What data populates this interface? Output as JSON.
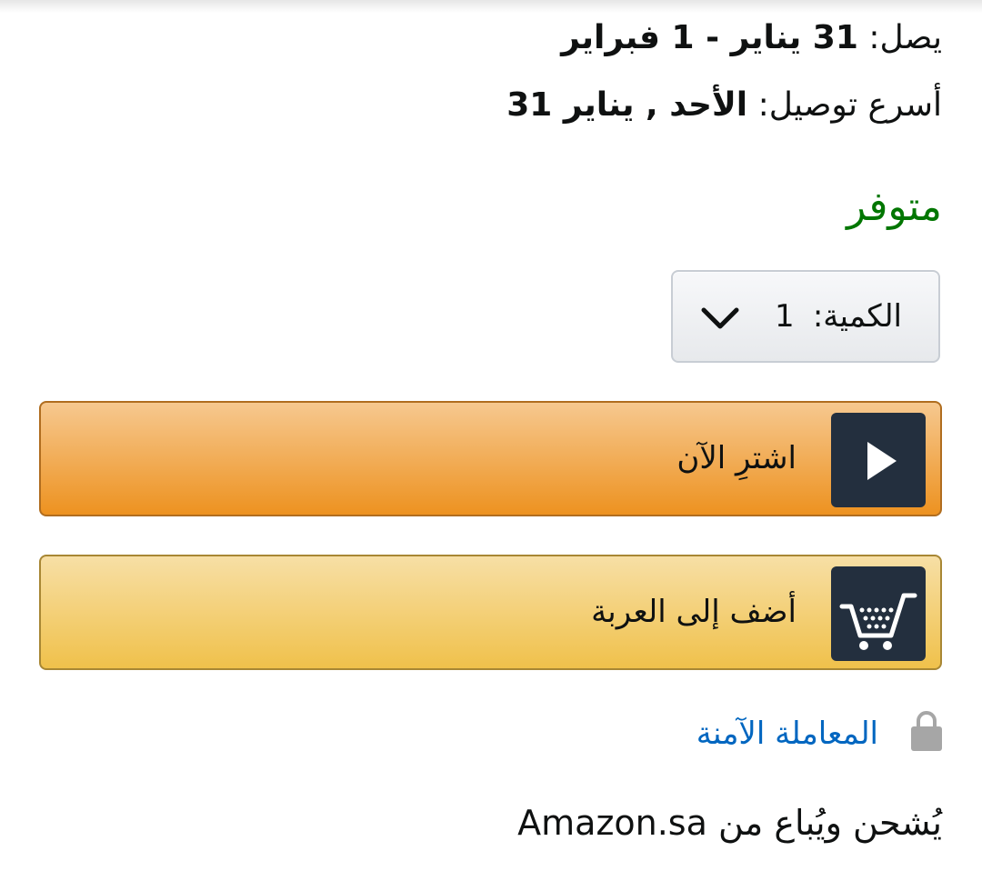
{
  "delivery": {
    "arrival_label": "يصل:",
    "arrival_value": "31 يناير - 1 فبراير",
    "fastest_label": "أسرع توصيل:",
    "fastest_value": "الأحد , يناير 31"
  },
  "availability": {
    "status": "متوفر",
    "color": "#007600"
  },
  "quantity": {
    "label": "الكمية:",
    "value": "1",
    "icon": "chevron-down-icon"
  },
  "buttons": {
    "buy_now": {
      "label": "اشترِ الآن",
      "icon": "play-icon",
      "color": "#ed9220"
    },
    "add_to_cart": {
      "label": "أضف إلى العربة",
      "icon": "cart-icon",
      "color": "#f0c14b"
    }
  },
  "secure_transaction": {
    "label": "المعاملة الآمنة",
    "icon": "lock-icon",
    "color": "#0066c0"
  },
  "seller": {
    "text": "يُشحن ويُباع من Amazon.sa"
  }
}
